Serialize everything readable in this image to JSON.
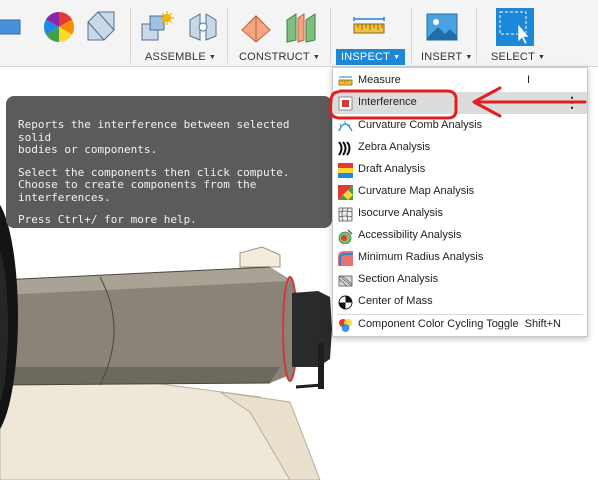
{
  "toolbar": {
    "groups": [
      {
        "label": "ASSEMBLE",
        "icon": "assemble-icon"
      },
      {
        "label": "CONSTRUCT",
        "icon": "construct-icon"
      },
      {
        "label": "INSPECT",
        "icon": "measure-ruler-icon",
        "active": true
      },
      {
        "label": "INSERT",
        "icon": "insert-image-icon"
      },
      {
        "label": "SELECT",
        "icon": "select-window-icon"
      }
    ]
  },
  "tooltip": {
    "line1": "Reports the interference between selected solid\nbodies or components.",
    "line2": "Select the components then click compute.\nChoose to create components from the\ninterferences.",
    "line3": "Press Ctrl+/ for more help."
  },
  "menu": {
    "items": [
      {
        "label": "Measure",
        "icon": "measure-icon",
        "shortcut": "I"
      },
      {
        "label": "Interference",
        "icon": "interference-icon",
        "highlighted": true
      },
      {
        "label": "Curvature Comb Analysis",
        "icon": "curvature-comb-icon"
      },
      {
        "label": "Zebra Analysis",
        "icon": "zebra-icon"
      },
      {
        "label": "Draft Analysis",
        "icon": "draft-analysis-icon"
      },
      {
        "label": "Curvature Map Analysis",
        "icon": "curvature-map-icon"
      },
      {
        "label": "Isocurve Analysis",
        "icon": "isocurve-icon"
      },
      {
        "label": "Accessibility Analysis",
        "icon": "accessibility-icon"
      },
      {
        "label": "Minimum Radius Analysis",
        "icon": "minimum-radius-icon"
      },
      {
        "label": "Section Analysis",
        "icon": "section-analysis-icon"
      },
      {
        "label": "Center of Mass",
        "icon": "center-of-mass-icon"
      },
      {
        "label": "Component Color Cycling Toggle",
        "icon": "color-cycling-icon",
        "shortcut": "Shift+N"
      }
    ]
  },
  "colors": {
    "accent": "#1e88d8",
    "annotation": "#e02020",
    "tooltip_bg": "#5b5b5b",
    "highlight_row": "#dcdcdc"
  }
}
